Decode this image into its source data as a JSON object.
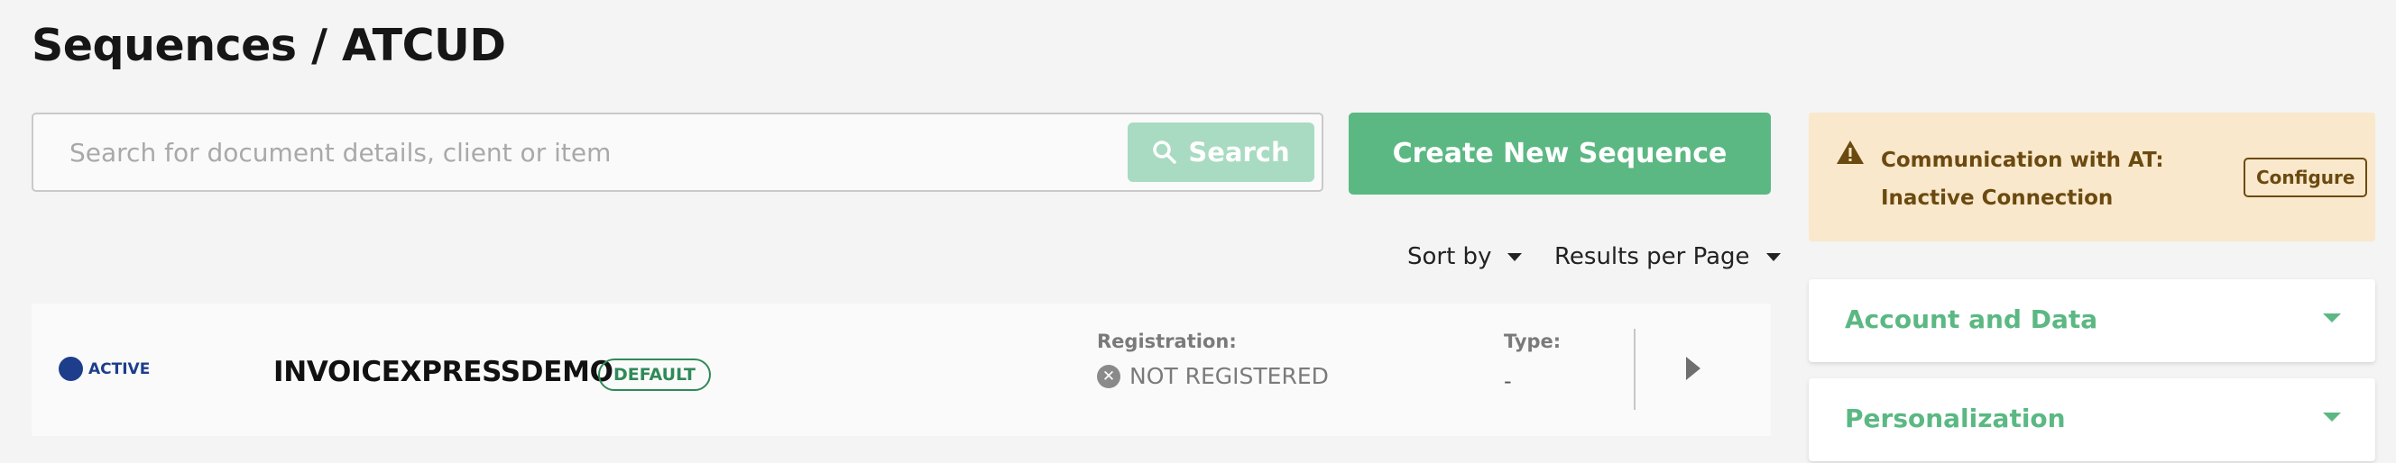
{
  "page": {
    "title": "Sequences / ATCUD"
  },
  "search": {
    "placeholder": "Search for document details, client or item",
    "button_label": "Search"
  },
  "actions": {
    "create_label": "Create New Sequence"
  },
  "controls": {
    "sort_label": "Sort by",
    "results_label": "Results per Page"
  },
  "sequence": {
    "status": "ACTIVE",
    "name": "INVOICEXPRESSDEMO",
    "badge": "DEFAULT",
    "registration_label": "Registration:",
    "registration_value": "NOT REGISTERED",
    "type_label": "Type:",
    "type_value": "-"
  },
  "alert": {
    "message": "Communication with AT: Inactive Connection",
    "button_label": "Configure"
  },
  "panels": [
    {
      "title": "Account and Data"
    },
    {
      "title": "Personalization"
    }
  ],
  "colors": {
    "brand_green": "#5bb883",
    "status_blue": "#1e3e8c",
    "alert_bg": "#f9e8cb",
    "alert_text": "#6b4a10"
  },
  "icons": [
    "search-icon",
    "chevron-down-icon",
    "status-dot-icon",
    "x-circle-icon",
    "chevron-right-icon",
    "warning-icon"
  ]
}
